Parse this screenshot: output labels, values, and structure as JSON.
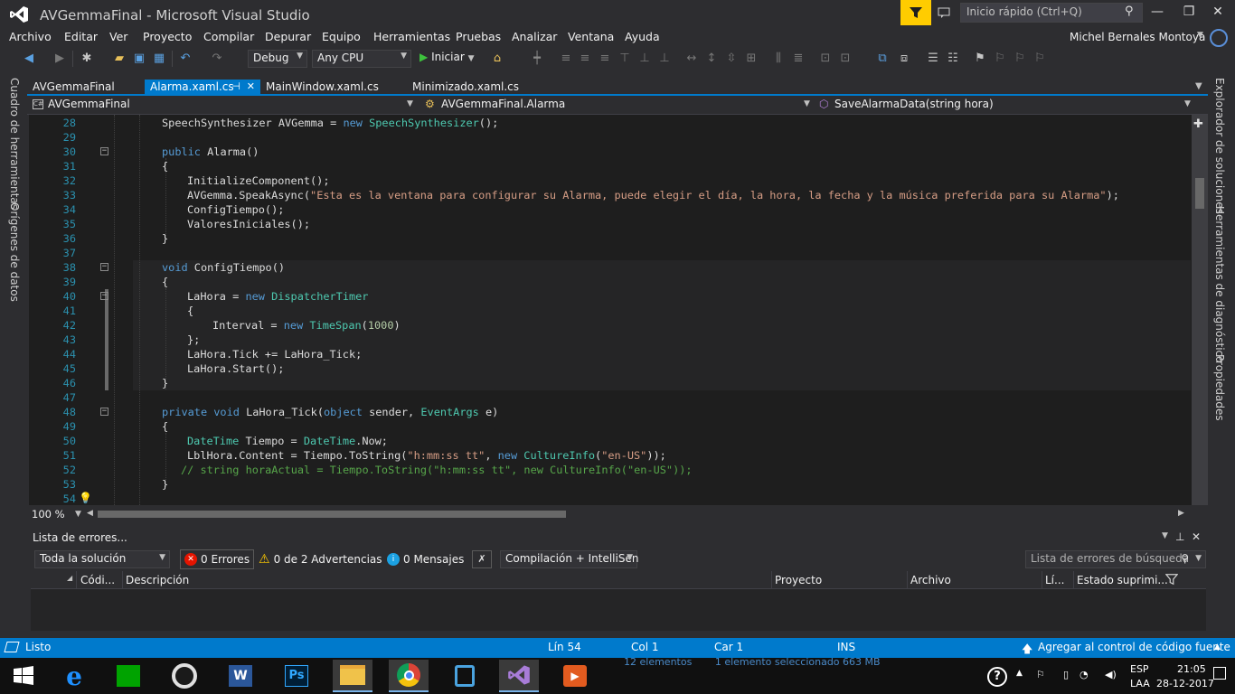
{
  "window": {
    "title": "AVGemmaFinal - Microsoft Visual Studio",
    "quick_launch_placeholder": "Inicio rápido (Ctrl+Q)"
  },
  "menu": [
    "Archivo",
    "Editar",
    "Ver",
    "Proyecto",
    "Compilar",
    "Depurar",
    "Equipo",
    "Herramientas",
    "Pruebas",
    "Analizar",
    "Ventana",
    "Ayuda"
  ],
  "user": {
    "name": "Michel Bernales Montoya"
  },
  "toolbar": {
    "config": "Debug",
    "platform": "Any CPU",
    "start_label": "Iniciar"
  },
  "left_strip": {
    "tool1": "Cuadro de herramientas",
    "tool2": "Orígenes de datos"
  },
  "right_strip": {
    "tool1": "Explorador de soluciones",
    "tool2": "Herramientas de diagnóstico",
    "tool3": "Propiedades"
  },
  "tabs": [
    {
      "label": "AVGemmaFinal",
      "active": false
    },
    {
      "label": "Alarma.xaml.cs",
      "active": true,
      "pin": "⊣"
    },
    {
      "label": "MainWindow.xaml.cs",
      "active": false
    },
    {
      "label": "Minimizado.xaml.cs",
      "active": false
    }
  ],
  "navbar": {
    "project": "AVGemmaFinal",
    "class": "AVGemmaFinal.Alarma",
    "member": "SaveAlarmaData(string hora)"
  },
  "code": [
    {
      "n": "28",
      "indent": 2,
      "t": [
        [
          "id",
          "SpeechSynthesizer AVGemma = "
        ],
        [
          "kw",
          "new "
        ],
        [
          "ty",
          "SpeechSynthesizer"
        ],
        [
          "id",
          "();"
        ]
      ]
    },
    {
      "n": "29",
      "indent": 0,
      "t": []
    },
    {
      "n": "30",
      "indent": 2,
      "collapse": true,
      "t": [
        [
          "kw",
          "public "
        ],
        [
          "id",
          "Alarma()"
        ]
      ]
    },
    {
      "n": "31",
      "indent": 2,
      "t": [
        [
          "id",
          "{"
        ]
      ]
    },
    {
      "n": "32",
      "indent": 3,
      "t": [
        [
          "id",
          "InitializeComponent();"
        ]
      ]
    },
    {
      "n": "33",
      "indent": 3,
      "t": [
        [
          "id",
          "AVGemma.SpeakAsync("
        ],
        [
          "st",
          "\"Esta es la ventana para configurar su Alarma, puede elegir el día, la hora, la fecha y la música preferida para su Alarma\""
        ],
        [
          "id",
          ");"
        ]
      ]
    },
    {
      "n": "34",
      "indent": 3,
      "t": [
        [
          "id",
          "ConfigTiempo();"
        ]
      ]
    },
    {
      "n": "35",
      "indent": 3,
      "t": [
        [
          "id",
          "ValoresIniciales();"
        ]
      ]
    },
    {
      "n": "36",
      "indent": 2,
      "t": [
        [
          "id",
          "}"
        ]
      ]
    },
    {
      "n": "37",
      "indent": 0,
      "t": []
    },
    {
      "n": "38",
      "indent": 2,
      "collapse": true,
      "t": [
        [
          "kw",
          "void "
        ],
        [
          "id",
          "ConfigTiempo()"
        ]
      ]
    },
    {
      "n": "39",
      "indent": 2,
      "t": [
        [
          "id",
          "{"
        ]
      ]
    },
    {
      "n": "40",
      "indent": 3,
      "collapse": true,
      "t": [
        [
          "id",
          "LaHora = "
        ],
        [
          "kw",
          "new "
        ],
        [
          "ty",
          "DispatcherTimer"
        ]
      ]
    },
    {
      "n": "41",
      "indent": 3,
      "t": [
        [
          "id",
          "{"
        ]
      ]
    },
    {
      "n": "42",
      "indent": 4,
      "t": [
        [
          "id",
          "Interval = "
        ],
        [
          "kw",
          "new "
        ],
        [
          "ty",
          "TimeSpan"
        ],
        [
          "id",
          "("
        ],
        [
          "nm",
          "1000"
        ],
        [
          "id",
          ")"
        ]
      ]
    },
    {
      "n": "43",
      "indent": 3,
      "t": [
        [
          "id",
          "};"
        ]
      ]
    },
    {
      "n": "44",
      "indent": 3,
      "t": [
        [
          "id",
          "LaHora.Tick += LaHora_Tick;"
        ]
      ]
    },
    {
      "n": "45",
      "indent": 3,
      "t": [
        [
          "id",
          "LaHora.Start();"
        ]
      ]
    },
    {
      "n": "46",
      "indent": 2,
      "t": [
        [
          "id",
          "}"
        ]
      ]
    },
    {
      "n": "47",
      "indent": 0,
      "t": []
    },
    {
      "n": "48",
      "indent": 2,
      "collapse": true,
      "t": [
        [
          "kw",
          "private void "
        ],
        [
          "id",
          "LaHora_Tick("
        ],
        [
          "kw",
          "object "
        ],
        [
          "id",
          "sender, "
        ],
        [
          "ty",
          "EventArgs "
        ],
        [
          "id",
          "e)"
        ]
      ]
    },
    {
      "n": "49",
      "indent": 2,
      "t": [
        [
          "id",
          "{"
        ]
      ]
    },
    {
      "n": "50",
      "indent": 3,
      "t": [
        [
          "ty",
          "DateTime "
        ],
        [
          "id",
          "Tiempo = "
        ],
        [
          "ty",
          "DateTime"
        ],
        [
          "id",
          ".Now;"
        ]
      ]
    },
    {
      "n": "51",
      "indent": 3,
      "t": [
        [
          "id",
          "LblHora.Content = Tiempo.ToString("
        ],
        [
          "st",
          "\"h:mm:ss tt\""
        ],
        [
          "id",
          ", "
        ],
        [
          "kw",
          "new "
        ],
        [
          "ty",
          "CultureInfo"
        ],
        [
          "id",
          "("
        ],
        [
          "st",
          "\"en-US\""
        ],
        [
          "id",
          "));"
        ]
      ]
    },
    {
      "n": "52",
      "indent": 2.75,
      "t": [
        [
          "cm",
          "// string horaActual = Tiempo.ToString(\"h:mm:ss tt\", new CultureInfo(\"en-US\"));"
        ]
      ]
    },
    {
      "n": "53",
      "indent": 2,
      "t": [
        [
          "id",
          "}"
        ]
      ]
    },
    {
      "n": "54",
      "indent": 0,
      "t": []
    }
  ],
  "editor": {
    "zoom": "100 %"
  },
  "error_list": {
    "title": "Lista de errores...",
    "scope": "Toda la solución",
    "errors": "0 Errores",
    "warnings": "0 de 2 Advertencias",
    "messages": "0 Mensajes",
    "build_filter": "Compilación + IntelliSen",
    "search_placeholder": "Lista de errores de búsqueda",
    "columns": [
      "Códi...",
      "Descripción",
      "Proyecto",
      "Archivo",
      "Lí...",
      "Estado suprimi..."
    ]
  },
  "status": {
    "ready": "Listo",
    "line": "Lín 54",
    "col": "Col 1",
    "car": "Car 1",
    "ins": "INS",
    "source_control": "Agregar al control de código fuente"
  },
  "explorer_status": {
    "items": "12 elementos",
    "selected": "1 elemento seleccionado  663 MB"
  },
  "tray": {
    "lang": "ESP",
    "layout": "LAA",
    "time": "21:05",
    "date": "28-12-2017"
  },
  "colors": {
    "accent": "#007acc",
    "editor_bg": "#1e1e1e",
    "keyword": "#569cd6",
    "type": "#4ec9b0",
    "string": "#d69d85",
    "comment": "#57a64a",
    "linenumber": "#2b91af"
  }
}
